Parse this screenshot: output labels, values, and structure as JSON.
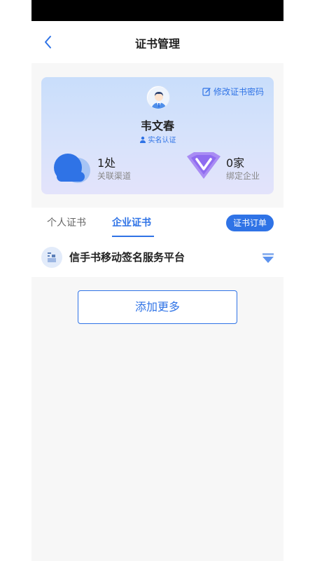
{
  "header": {
    "title": "证书管理"
  },
  "card": {
    "edit_password_label": "修改证书密码",
    "user_name": "韦文春",
    "verified_label": "实名认证",
    "channels": {
      "value": "1处",
      "label": "关联渠道"
    },
    "enterprises": {
      "value": "0家",
      "label": "绑定企业"
    }
  },
  "tabs": {
    "personal": "个人证书",
    "enterprise": "企业证书",
    "active": "enterprise",
    "order_button": "证书订单"
  },
  "platform": {
    "name": "信手书移动签名服务平台"
  },
  "actions": {
    "add_more": "添加更多"
  },
  "colors": {
    "accent": "#2f73e6",
    "card_gradient_top": "#c9defb",
    "card_gradient_bottom": "#e3e3fb",
    "v_badge": "#8f6cf0"
  }
}
